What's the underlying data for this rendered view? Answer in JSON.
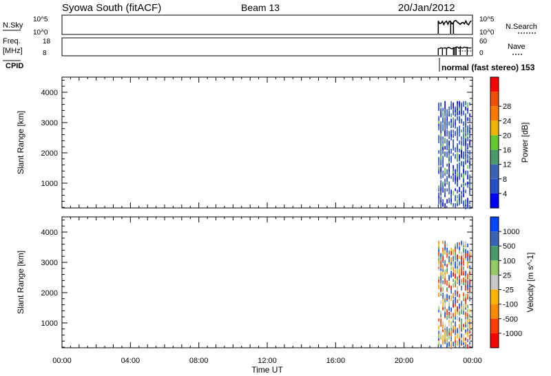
{
  "header": {
    "station": "Syowa South (fitACF)",
    "beam": "Beam 13",
    "date": "20/Jan/2012"
  },
  "strip_panels": {
    "nsky": {
      "label": "N.Sky",
      "ticks": [
        "10^5",
        "10^0"
      ],
      "right_ticks": [
        "10^5",
        "10^0"
      ],
      "right_label": "N.Search"
    },
    "freq": {
      "label_line1": "Freq.",
      "label_line2": "[MHz]",
      "ticks": [
        "18",
        "8"
      ],
      "right_ticks": [
        "60",
        "0"
      ],
      "right_label": "Nave"
    },
    "cpid": {
      "label": "CPID",
      "value": "normal (fast stereo) 153"
    }
  },
  "colors": {
    "power_scale": [
      "#0000ff",
      "#2850c8",
      "#3c64b4",
      "#4a9a6a",
      "#64c832",
      "#f0b400",
      "#ff7800",
      "#f05000",
      "#ff0000"
    ],
    "velocity_scale": [
      "#ff0000",
      "#ff3c00",
      "#ff8c00",
      "#ffb400",
      "#c8c8c8",
      "#96c864",
      "#4a9a6a",
      "#3c64b4",
      "#0046ff"
    ]
  },
  "chart_data": [
    {
      "type": "heatmap",
      "name": "power",
      "title": "",
      "ylabel": "Slant Range [km]",
      "yticks": [
        1000,
        2000,
        3000,
        4000
      ],
      "ylim": [
        180,
        4500
      ],
      "xlim": [
        0,
        24
      ],
      "colorbar_label": "Power [dB]",
      "colorbar_ticks": [
        "4",
        "8",
        "12",
        "16",
        "20",
        "24",
        "28"
      ],
      "data_start_hour": 22.0,
      "data_end_hour": 24.0,
      "data_max_range_km": 3650,
      "dominant_value": 4
    },
    {
      "type": "heatmap",
      "name": "velocity",
      "title": "",
      "ylabel": "Slant Range [km]",
      "yticks": [
        1000,
        2000,
        3000,
        4000
      ],
      "ylim": [
        180,
        4500
      ],
      "xlim": [
        0,
        24
      ],
      "colorbar_label": "Velocity [m s^-1]",
      "colorbar_ticks": [
        "1000",
        "500",
        "100",
        "25",
        "-25",
        "-100",
        "-500",
        "-1000"
      ],
      "data_start_hour": 22.0,
      "data_end_hour": 24.0,
      "data_max_range_km": 3650
    }
  ],
  "x_axis": {
    "label": "Time UT",
    "ticks": [
      "00:00",
      "04:00",
      "08:00",
      "12:00",
      "16:00",
      "20:00",
      "00:00"
    ]
  }
}
